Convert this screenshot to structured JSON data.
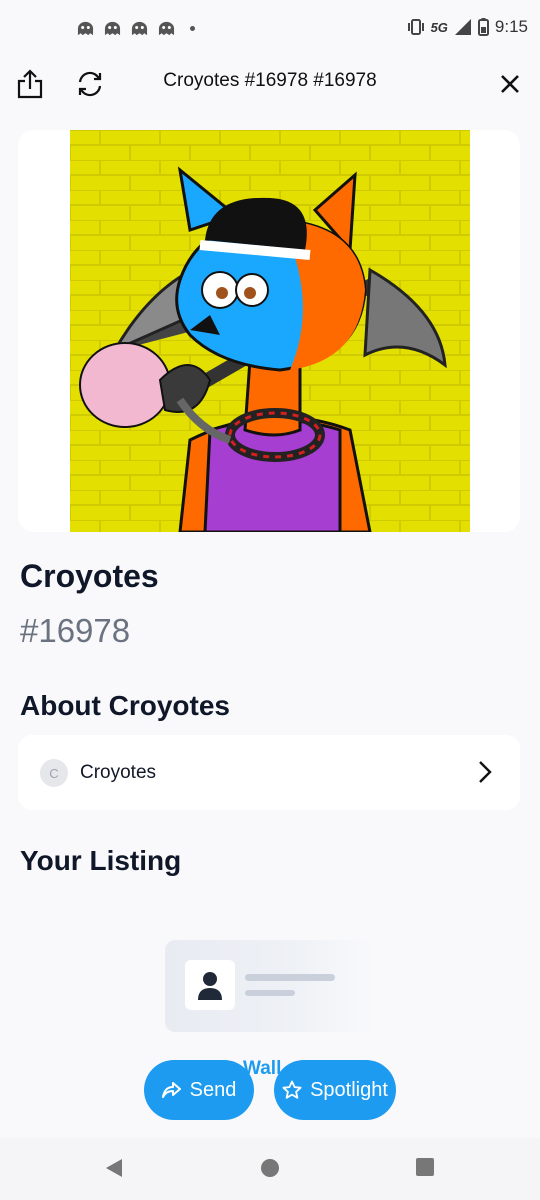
{
  "status": {
    "time": "9:15",
    "network": "5G"
  },
  "header": {
    "title": "Croyotes #16978 #16978"
  },
  "nft": {
    "collection": "Croyotes",
    "token_id": "#16978"
  },
  "about": {
    "heading": "About Croyotes",
    "collection_name": "Croyotes",
    "avatar_letter": "C"
  },
  "listing": {
    "heading": "Your Listing",
    "partial_text": "Wall"
  },
  "actions": {
    "send_label": "Send",
    "spotlight_label": "Spotlight"
  },
  "colors": {
    "accent": "#1d9bf0",
    "art_background": "#e3df00"
  }
}
